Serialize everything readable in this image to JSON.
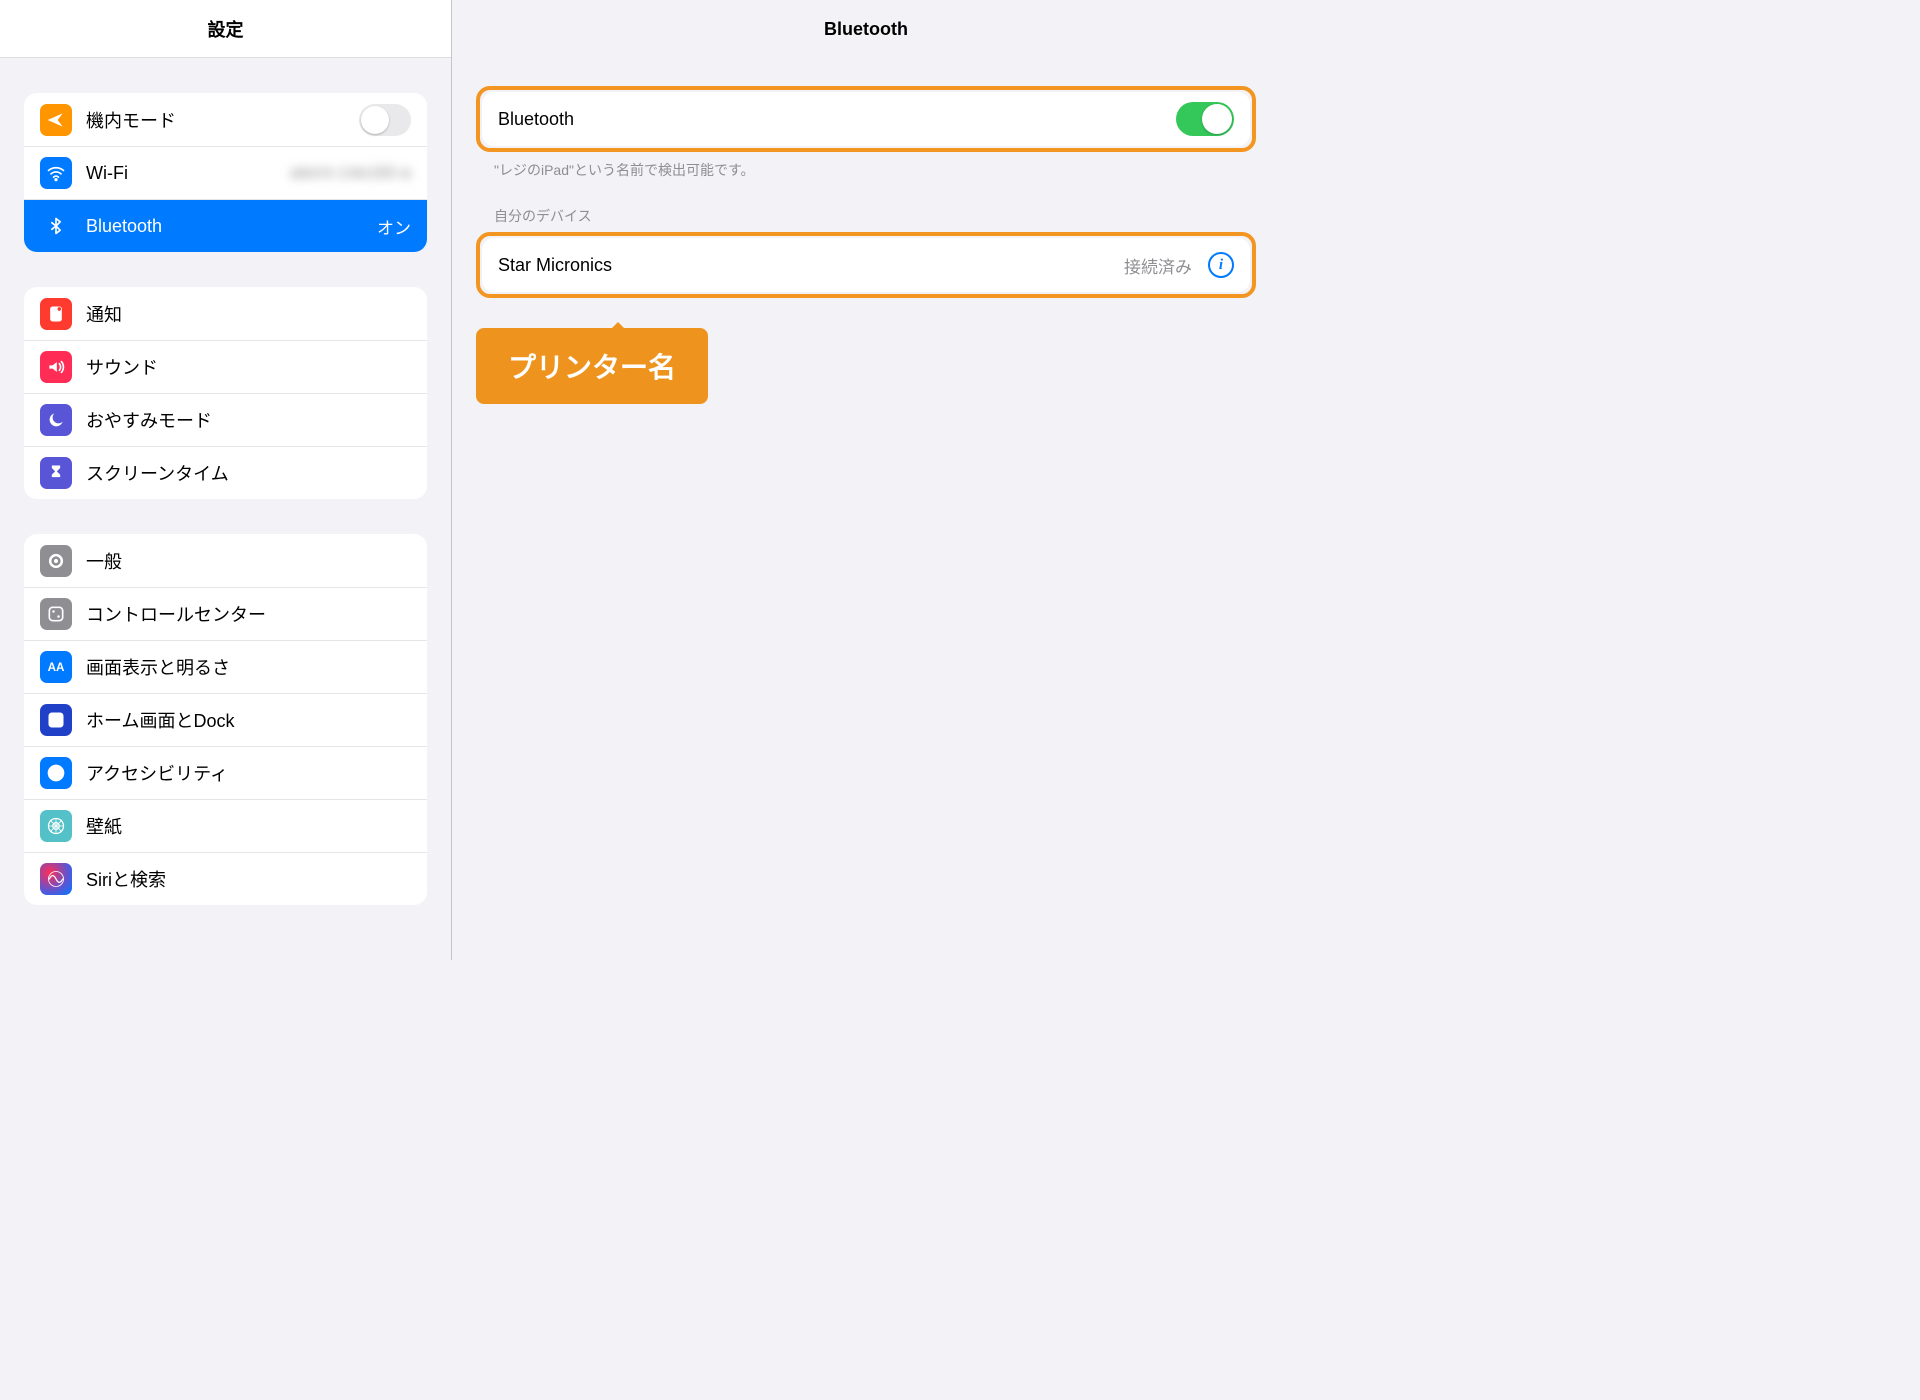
{
  "sidebar": {
    "title": "設定",
    "groups": [
      {
        "items": [
          {
            "id": "airplane-mode",
            "label": "機内モード",
            "icon": "airplane-icon",
            "color": "#ff9500",
            "switch": "off"
          },
          {
            "id": "wifi",
            "label": "Wi-Fi",
            "icon": "wifi-icon",
            "color": "#007aff",
            "value": "aterm-14e160-a",
            "value_blurred": true
          },
          {
            "id": "bluetooth",
            "label": "Bluetooth",
            "icon": "bluetooth-icon",
            "color": "#007aff",
            "value": "オン",
            "selected": true
          }
        ]
      },
      {
        "items": [
          {
            "id": "notifications",
            "label": "通知",
            "icon": "notifications-icon",
            "color": "#ff3b30"
          },
          {
            "id": "sounds",
            "label": "サウンド",
            "icon": "sounds-icon",
            "color": "#ff2d55"
          },
          {
            "id": "do-not-disturb",
            "label": "おやすみモード",
            "icon": "moon-icon",
            "color": "#5856d6"
          },
          {
            "id": "screen-time",
            "label": "スクリーンタイム",
            "icon": "hourglass-icon",
            "color": "#5856d6"
          }
        ]
      },
      {
        "items": [
          {
            "id": "general",
            "label": "一般",
            "icon": "gear-icon",
            "color": "#8e8e93"
          },
          {
            "id": "control-center",
            "label": "コントロールセンター",
            "icon": "control-center-icon",
            "color": "#8e8e93"
          },
          {
            "id": "display",
            "label": "画面表示と明るさ",
            "icon": "aa-icon",
            "color": "#007aff"
          },
          {
            "id": "home-dock",
            "label": "ホーム画面とDock",
            "icon": "home-dock-icon",
            "color": "#2041c7"
          },
          {
            "id": "accessibility",
            "label": "アクセシビリティ",
            "icon": "accessibility-icon",
            "color": "#007aff"
          },
          {
            "id": "wallpaper",
            "label": "壁紙",
            "icon": "wallpaper-icon",
            "color": "#54c1c8"
          },
          {
            "id": "siri",
            "label": "Siriと検索",
            "icon": "siri-icon",
            "color": "siri"
          }
        ]
      }
    ]
  },
  "main": {
    "title": "Bluetooth",
    "toggle_label": "Bluetooth",
    "toggle_state": "on",
    "discoverable_text": "\"レジのiPad\"という名前で検出可能です。",
    "devices_title": "自分のデバイス",
    "devices": [
      {
        "name": "Star Micronics",
        "status": "接続済み"
      }
    ],
    "callout": "プリンター名"
  }
}
